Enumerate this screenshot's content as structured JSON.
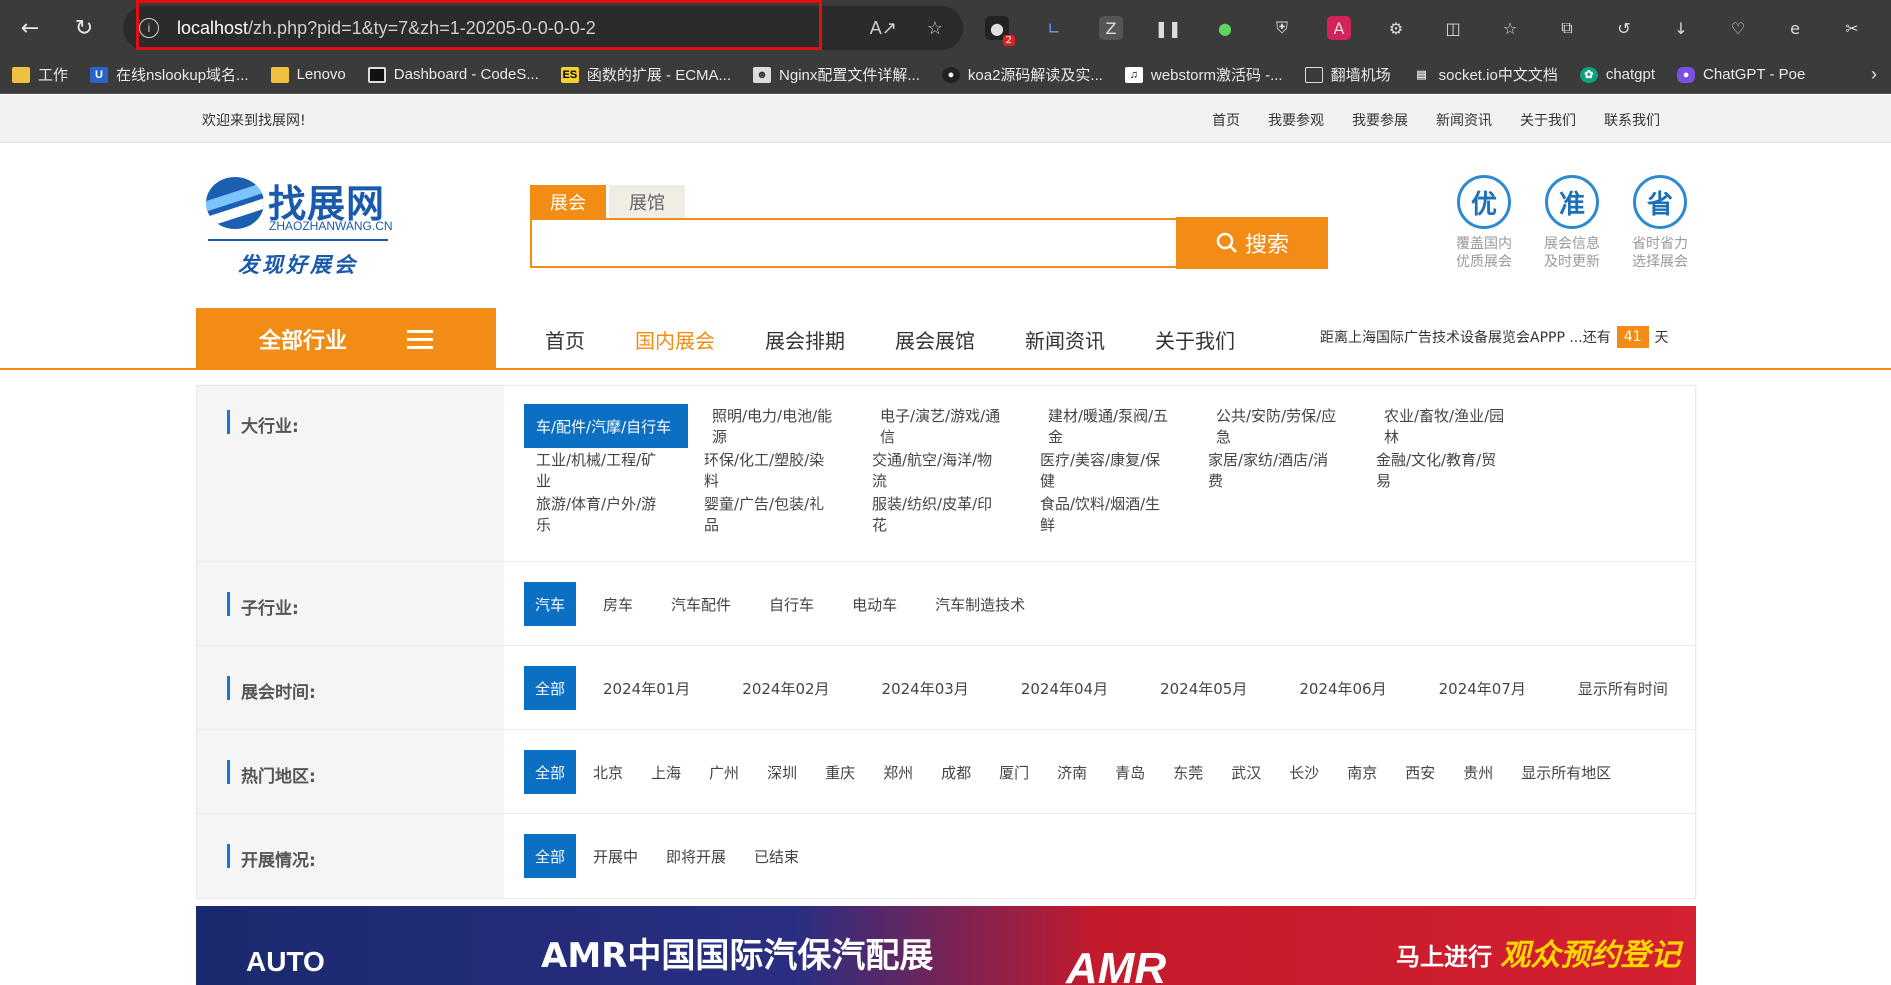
{
  "browser": {
    "url_host": "localhost",
    "url_path": "/zh.php?pid=1&ty=7&zh=1-20205-0-0-0-0-2",
    "ext_badge": "2",
    "bookmarks": [
      {
        "label": "工作",
        "icon": "folder-icon"
      },
      {
        "label": "在线nslookup域名...",
        "icon": "u-icon"
      },
      {
        "label": "Lenovo",
        "icon": "folder-icon"
      },
      {
        "label": "Dashboard - CodeS...",
        "icon": "square-icon"
      },
      {
        "label": "函数的扩展 - ECMA...",
        "icon": "es-icon"
      },
      {
        "label": "Nginx配置文件详解...",
        "icon": "avatar-icon"
      },
      {
        "label": "koa2源码解读及实...",
        "icon": "github-icon"
      },
      {
        "label": "webstorm激活码 -...",
        "icon": "tiktok-icon"
      },
      {
        "label": "翻墙机场",
        "icon": "file-icon"
      },
      {
        "label": "socket.io中文文档",
        "icon": "book-icon"
      },
      {
        "label": "chatgpt",
        "icon": "chatgpt-icon"
      },
      {
        "label": "ChatGPT - Poe",
        "icon": "poe-icon"
      }
    ]
  },
  "topbar": {
    "welcome": "欢迎来到找展网!",
    "links": [
      "首页",
      "我要参观",
      "我要参展",
      "新闻资讯",
      "关于我们",
      "联系我们"
    ]
  },
  "logo": {
    "name": "找展网",
    "en": "ZHAOZHANWANG.CN",
    "slogan": "发现好展会"
  },
  "search": {
    "tab_active": "展会",
    "tab_other": "展馆",
    "placeholder": "",
    "button": "搜索"
  },
  "features": [
    {
      "char": "优",
      "line1": "覆盖国内",
      "line2": "优质展会"
    },
    {
      "char": "准",
      "line1": "展会信息",
      "line2": "及时更新"
    },
    {
      "char": "省",
      "line1": "省时省力",
      "line2": "选择展会"
    }
  ],
  "nav": {
    "all_industries": "全部行业",
    "items": [
      "首页",
      "国内展会",
      "展会排期",
      "展会展馆",
      "新闻资讯",
      "关于我们"
    ],
    "countdown_text": "距离上海国际广告技术设备展览会APPP ...还有",
    "countdown_value": "41",
    "countdown_unit": "天"
  },
  "filters": {
    "industry": {
      "label": "大行业:",
      "values": [
        "车/配件/汽摩/自行车",
        "照明/电力/电池/能源",
        "电子/演艺/游戏/通信",
        "建材/暖通/泵阀/五金",
        "公共/安防/劳保/应急",
        "农业/畜牧/渔业/园林",
        "工业/机械/工程/矿业",
        "环保/化工/塑胶/染料",
        "交通/航空/海洋/物流",
        "医疗/美容/康复/保健",
        "家居/家纺/酒店/消费",
        "金融/文化/教育/贸易",
        "旅游/体育/户外/游乐",
        "婴童/广告/包装/礼品",
        "服装/纺织/皮革/印花",
        "食品/饮料/烟酒/生鲜"
      ]
    },
    "sub": {
      "label": "子行业:",
      "values": [
        "汽车",
        "房车",
        "汽车配件",
        "自行车",
        "电动车",
        "汽车制造技术"
      ]
    },
    "time": {
      "label": "展会时间:",
      "values": [
        "全部",
        "2024年01月",
        "2024年02月",
        "2024年03月",
        "2024年04月",
        "2024年05月",
        "2024年06月",
        "2024年07月",
        "显示所有时间"
      ]
    },
    "region": {
      "label": "热门地区:",
      "values": [
        "全部",
        "北京",
        "上海",
        "广州",
        "深圳",
        "重庆",
        "郑州",
        "成都",
        "厦门",
        "济南",
        "青岛",
        "东莞",
        "武汉",
        "长沙",
        "南京",
        "西安",
        "贵州",
        "显示所有地区"
      ]
    },
    "status": {
      "label": "开展情况:",
      "values": [
        "全部",
        "开展中",
        "即将开展",
        "已结束"
      ]
    }
  },
  "banner": {
    "auto": "AUTO",
    "title": "AMR中国国际汽保汽配展",
    "amr": "AMR",
    "cta_prefix": "马上进行",
    "cta_highlight": "观众预约登记"
  }
}
